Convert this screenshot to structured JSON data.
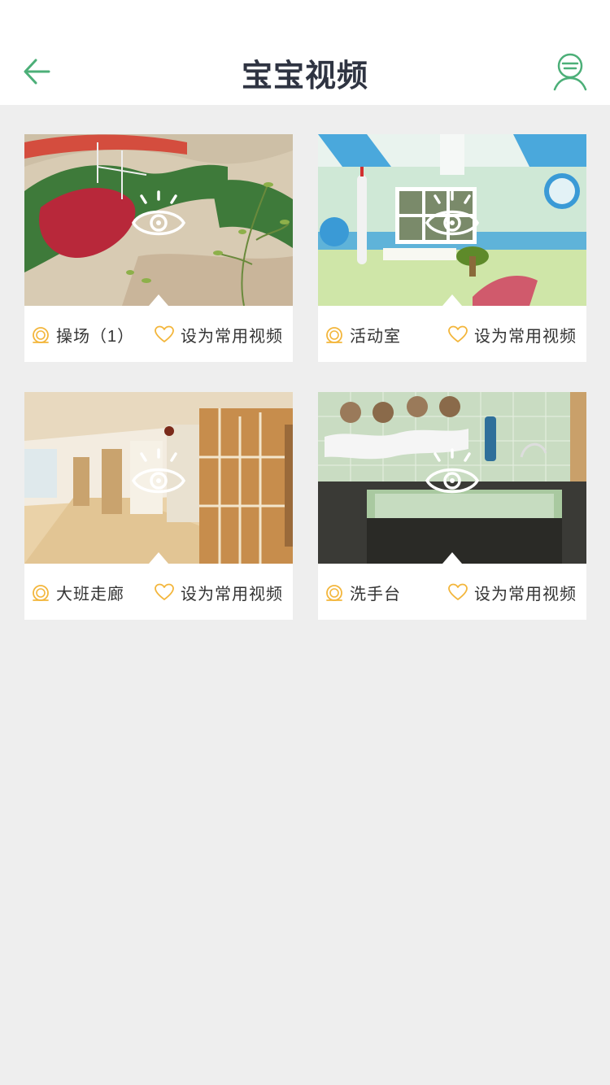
{
  "header": {
    "title": "宝宝视频",
    "back_icon": "arrow-left-icon",
    "profile_icon": "user-avatar-icon",
    "accent_color": "#4caf78"
  },
  "videos": [
    {
      "name": "操场（1）",
      "scene": "playground",
      "favorite_label": "设为常用视频"
    },
    {
      "name": "活动室",
      "scene": "activity-room",
      "favorite_label": "设为常用视频"
    },
    {
      "name": "大班走廊",
      "scene": "hallway",
      "favorite_label": "设为常用视频"
    },
    {
      "name": "洗手台",
      "scene": "washroom",
      "favorite_label": "设为常用视频"
    }
  ],
  "icons": {
    "play_overlay": "eye-icon",
    "camera": "camera-lens-icon",
    "favorite": "heart-icon",
    "favorite_color": "#f3b63c"
  }
}
